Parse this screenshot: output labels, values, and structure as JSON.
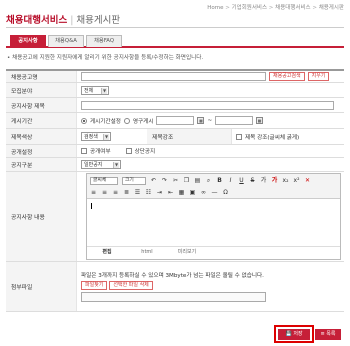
{
  "breadcrumb": [
    "Home",
    "기업회원서비스",
    "채용대행서비스",
    "채용게시판"
  ],
  "header": {
    "title": "채용대행서비스",
    "subtitle": "채용게시판"
  },
  "tabs": [
    {
      "label": "공지사항",
      "active": true
    },
    {
      "label": "채용Q&A",
      "active": false
    },
    {
      "label": "채용FAQ",
      "active": false
    }
  ],
  "notice": "• 채용공고에 지원한 지원자에게 알리기 위한 공지사항을 등록/수정하는 화면입니다.",
  "form": {
    "job_posting": {
      "label": "채용공고명",
      "value": "",
      "select_button": "채용공고검색",
      "clear_button": "지우기"
    },
    "field": {
      "label": "모집분야",
      "value": "전체"
    },
    "notice_title": {
      "label": "공지사항 제목",
      "value": ""
    },
    "period": {
      "label": "게시기간",
      "option_set": "게시기간설정",
      "option_permanent": "영구게시",
      "start": "",
      "end": "",
      "separator": "~"
    },
    "title_color": {
      "label": "제목색상",
      "value": "검정색"
    },
    "title_emphasis": {
      "label": "제목강조",
      "checkbox_label": "제목 강조(글씨체 굵게)"
    },
    "public_setting": {
      "label": "공개설정",
      "public_label": "공개여부",
      "top_label": "상단공지"
    },
    "category": {
      "label": "공지구분",
      "value": "일반공지"
    },
    "content": {
      "label": "공지사항 내용"
    },
    "attachment": {
      "label": "첨부파일",
      "help": "파일은 3개까지 등록하실 수 있으며 3Mbyte가 넘는 파일은 올릴 수 없습니다.",
      "add_button": "파일찾기",
      "delete_button": "선택한 파일 삭제"
    }
  },
  "editor": {
    "font": "글씨체",
    "size": "크기",
    "tabs": [
      {
        "label": "편집",
        "active": true
      },
      {
        "label": "html",
        "active": false
      },
      {
        "label": "미리보기",
        "active": false
      }
    ]
  },
  "actions": {
    "save": "저장",
    "list": "목록"
  },
  "colors": {
    "brand": "#b80e2a",
    "accent": "#c61f38",
    "highlight": "#dd0000"
  }
}
